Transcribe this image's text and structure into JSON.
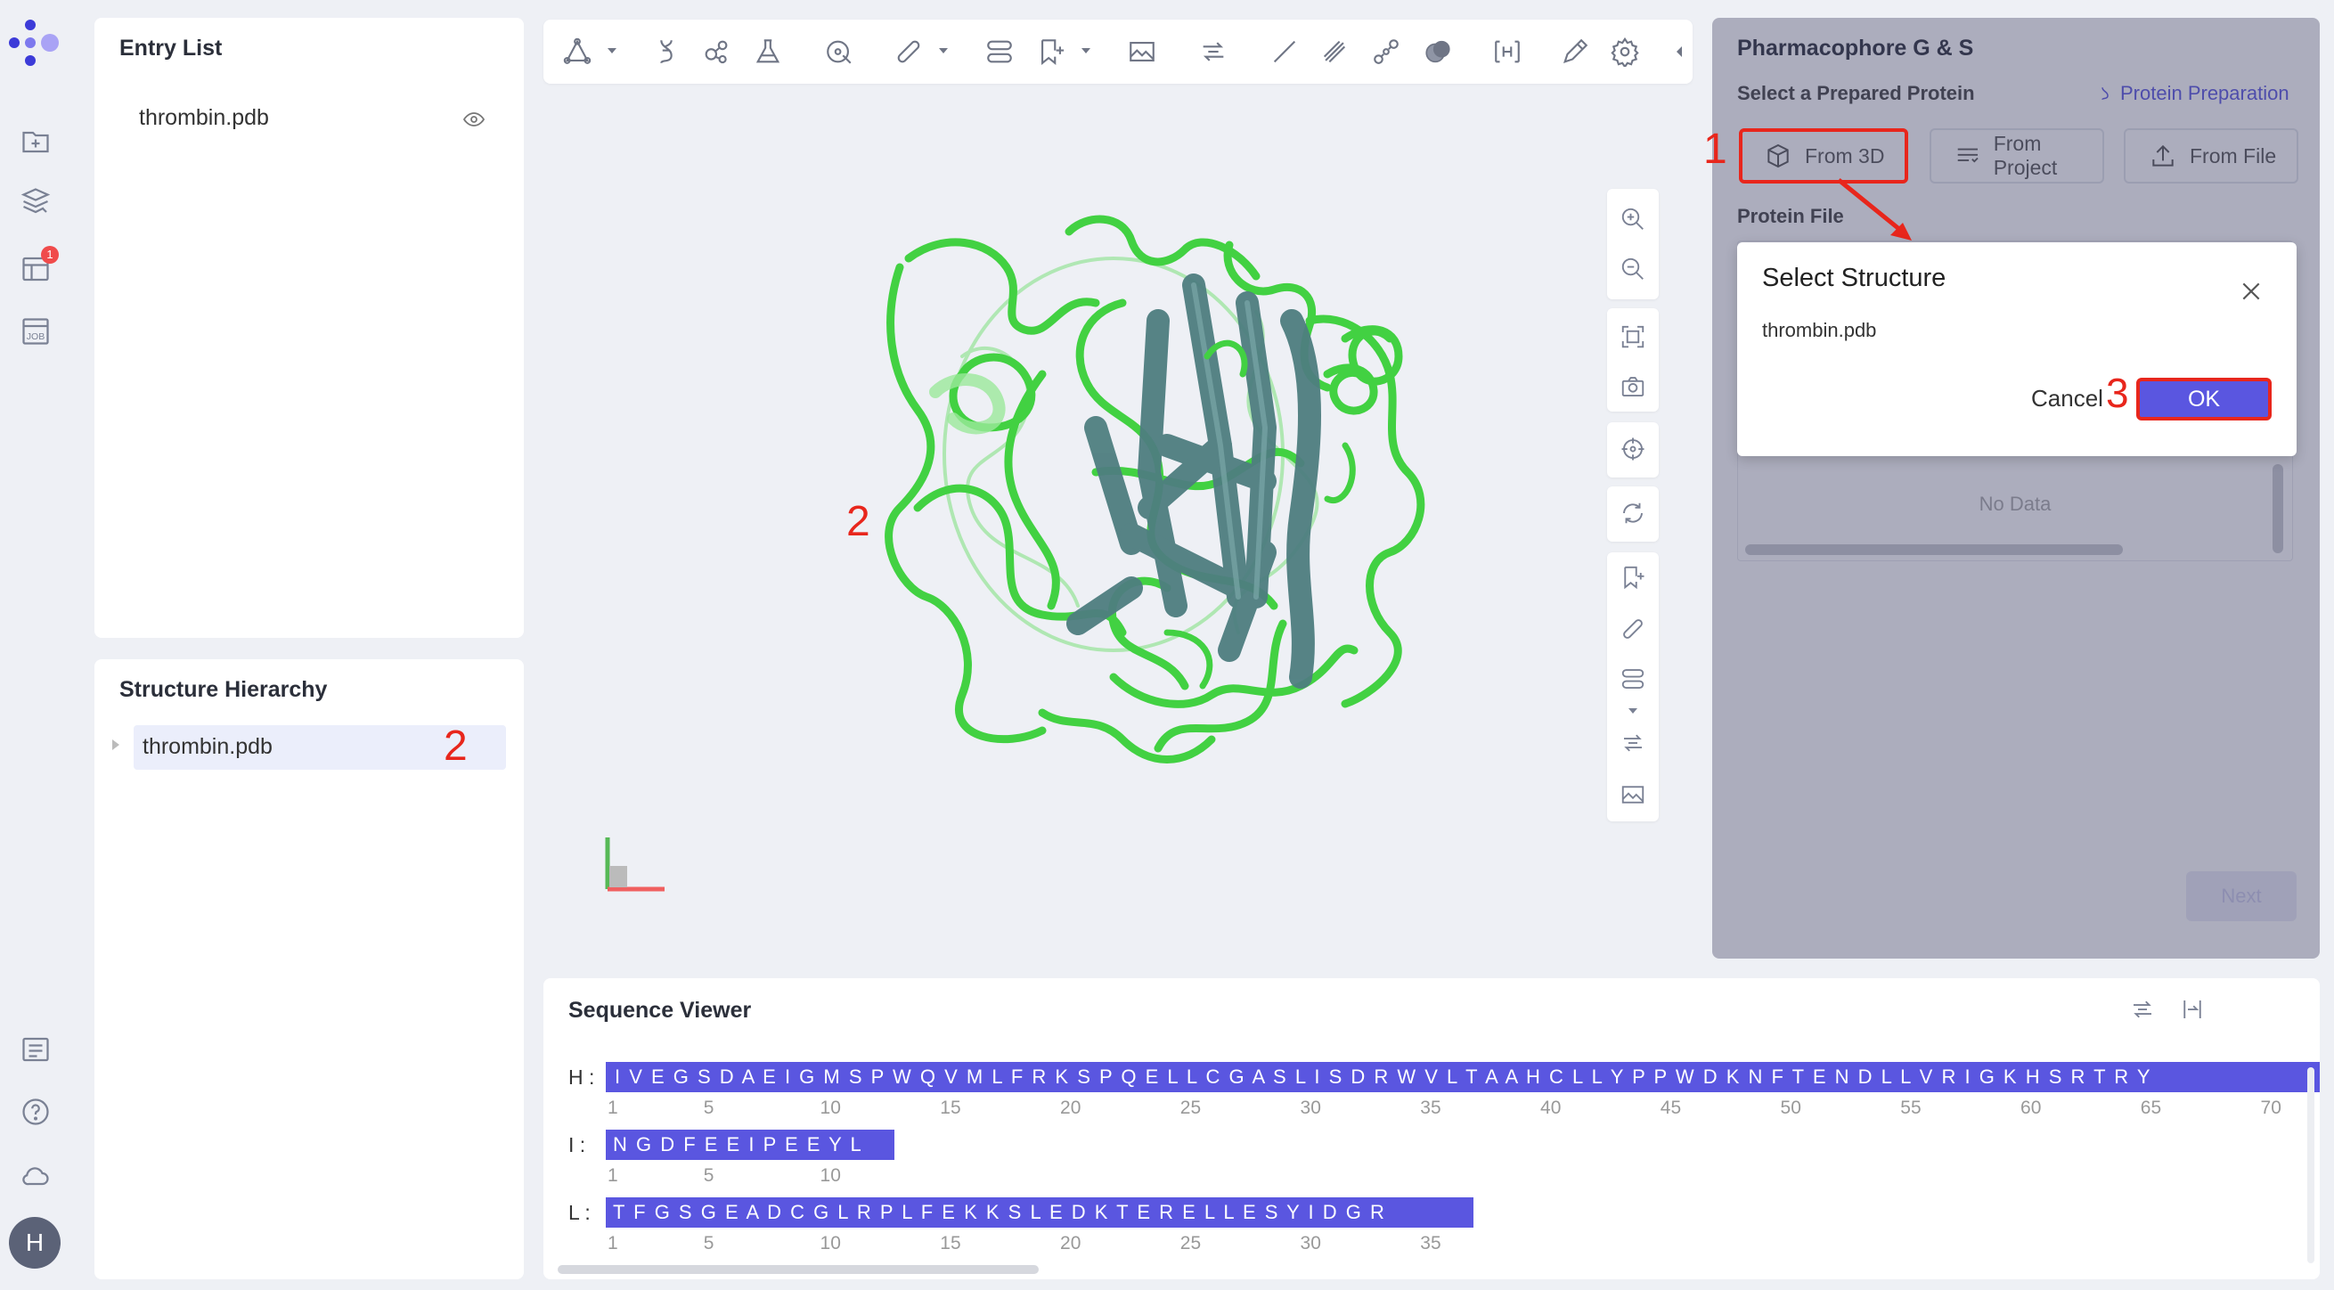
{
  "app": {
    "logo": "dots-logo"
  },
  "rail": {
    "items": [
      {
        "name": "add-folder-icon"
      },
      {
        "name": "layers-icon"
      },
      {
        "name": "table-icon",
        "badge": "1"
      },
      {
        "name": "job-icon",
        "label": "JOB"
      },
      {
        "name": "list-icon"
      },
      {
        "name": "help-icon",
        "label": "?"
      },
      {
        "name": "cloud-icon"
      }
    ],
    "avatar": "H"
  },
  "entry_list": {
    "title": "Entry List",
    "items": [
      {
        "label": "thrombin.pdb"
      }
    ]
  },
  "structure_hierarchy": {
    "title": "Structure Hierarchy",
    "items": [
      {
        "label": "thrombin.pdb"
      }
    ]
  },
  "viewer": {
    "annotation": "2"
  },
  "pharmacophore": {
    "title": "Pharmacophore G & S",
    "select_label": "Select a Prepared Protein",
    "prep_link": "Protein Preparation",
    "buttons": {
      "from_3d": "From 3D",
      "from_project": "From Project",
      "from_file": "From File"
    },
    "protein_file_label": "Protein File",
    "no_data": "No Data",
    "next_label": "Next"
  },
  "dialog": {
    "title": "Select Structure",
    "item": "thrombin.pdb",
    "cancel": "Cancel",
    "ok": "OK"
  },
  "annotations": {
    "a1": "1",
    "a2": "2",
    "a3": "3"
  },
  "sequence_viewer": {
    "title": "Sequence Viewer",
    "chains": [
      {
        "label": "H :",
        "sequence": "I V E G S D A E I G M S P W Q V M L F R K S P Q E L L C G A S L I S D R W V L T A A H C L L Y P P W D K N F T E N D L L V R I G K H S R T R Y",
        "ticks": [
          "1",
          "5",
          "10",
          "15",
          "20",
          "25",
          "30",
          "35",
          "40",
          "45",
          "50",
          "55",
          "60",
          "65",
          "70"
        ]
      },
      {
        "label": "I :",
        "sequence": "N G D F E E I P E E Y L",
        "ticks": [
          "1",
          "5",
          "10"
        ]
      },
      {
        "label": "L :",
        "sequence": "T F G S G E A D C G L R P L F E K K S L E D K T E R E L L E S Y I D G R",
        "ticks": [
          "1",
          "5",
          "10",
          "15",
          "20",
          "25",
          "30",
          "35"
        ]
      }
    ]
  },
  "colors": {
    "accent": "#5a56e0",
    "annotation_red": "#e8261c",
    "ribbon_green": "#4cd44c",
    "sheet_gray": "#4e7e80"
  }
}
